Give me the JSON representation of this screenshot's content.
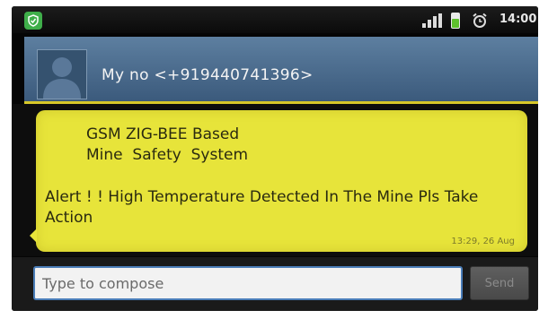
{
  "status_bar": {
    "time": "14:00",
    "icons": [
      "shield-icon",
      "signal-icon",
      "battery-icon",
      "alarm-icon"
    ]
  },
  "conversation": {
    "contact": "My no <+919440741396>",
    "avatar_icon": "person-silhouette-icon"
  },
  "message": {
    "title_line1": "GSM ZIG-BEE Based",
    "title_line2": "Mine  Safety  System",
    "body": "Alert ! ! High Temperature Detected In The Mine Pls Take Action",
    "timestamp": "13:29, 26 Aug"
  },
  "composer": {
    "placeholder": "Type to compose",
    "value": "",
    "send_label": "Send"
  },
  "colors": {
    "bubble": "#e7e43a",
    "header": "#4b6c8f",
    "compose_border": "#4a7db8"
  }
}
